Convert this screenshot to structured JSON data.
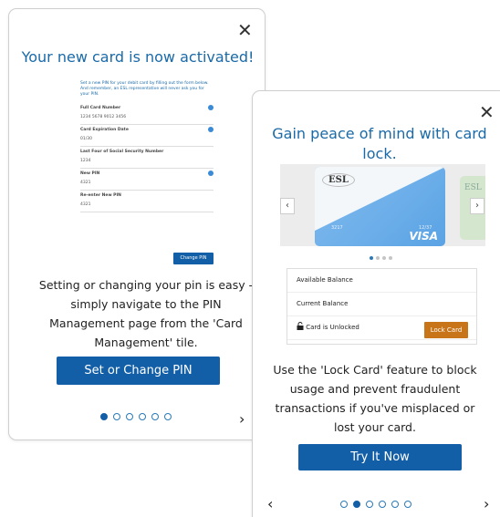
{
  "card1": {
    "close_glyph": "✕",
    "title": "Your new card is now activated!",
    "form": {
      "intro": "Set a new PIN for your debit card by filling out the form below. And remember, an ESL representative will never ask you for your PIN.",
      "fields": [
        {
          "label": "Full Card Number",
          "value": "1234 5678 9012 3456"
        },
        {
          "label": "Card Expiration Date",
          "value": "01/30"
        },
        {
          "label": "Last Four of Social Security Number",
          "value": "1234"
        },
        {
          "label": "New PIN",
          "value": "4321"
        },
        {
          "label": "Re-enter New PIN",
          "value": "4321"
        }
      ],
      "button": "Change PIN"
    },
    "body": "Setting or changing your pin is easy - simply navigate to the PIN Management page from the 'Card Management' tile.",
    "button": "Set or Change PIN",
    "next_glyph": "›"
  },
  "card2": {
    "close_glyph": "✕",
    "title": "Gain peace of mind with card lock.",
    "visa_card": {
      "logo": "ESL",
      "number": "3217",
      "expiry": "12/37",
      "brand": "VISA",
      "next_logo": "ESL"
    },
    "carousel_prev": "‹",
    "carousel_next": "›",
    "balance": {
      "available": "Available Balance",
      "current": "Current Balance",
      "status": "Card is Unlocked",
      "lock_button": "Lock Card"
    },
    "body": "Use the 'Lock Card' feature to block usage and prevent fraudulent transactions if you've misplaced or lost your card.",
    "button": "Try It Now",
    "prev_glyph": "‹",
    "next_glyph": "›"
  },
  "colors": {
    "primary": "#135fa7",
    "title": "#1a6aa8",
    "lock": "#c8751a"
  },
  "icons": [
    "close-icon",
    "info-icon",
    "chevron-left-icon",
    "chevron-right-icon",
    "lock-icon"
  ]
}
